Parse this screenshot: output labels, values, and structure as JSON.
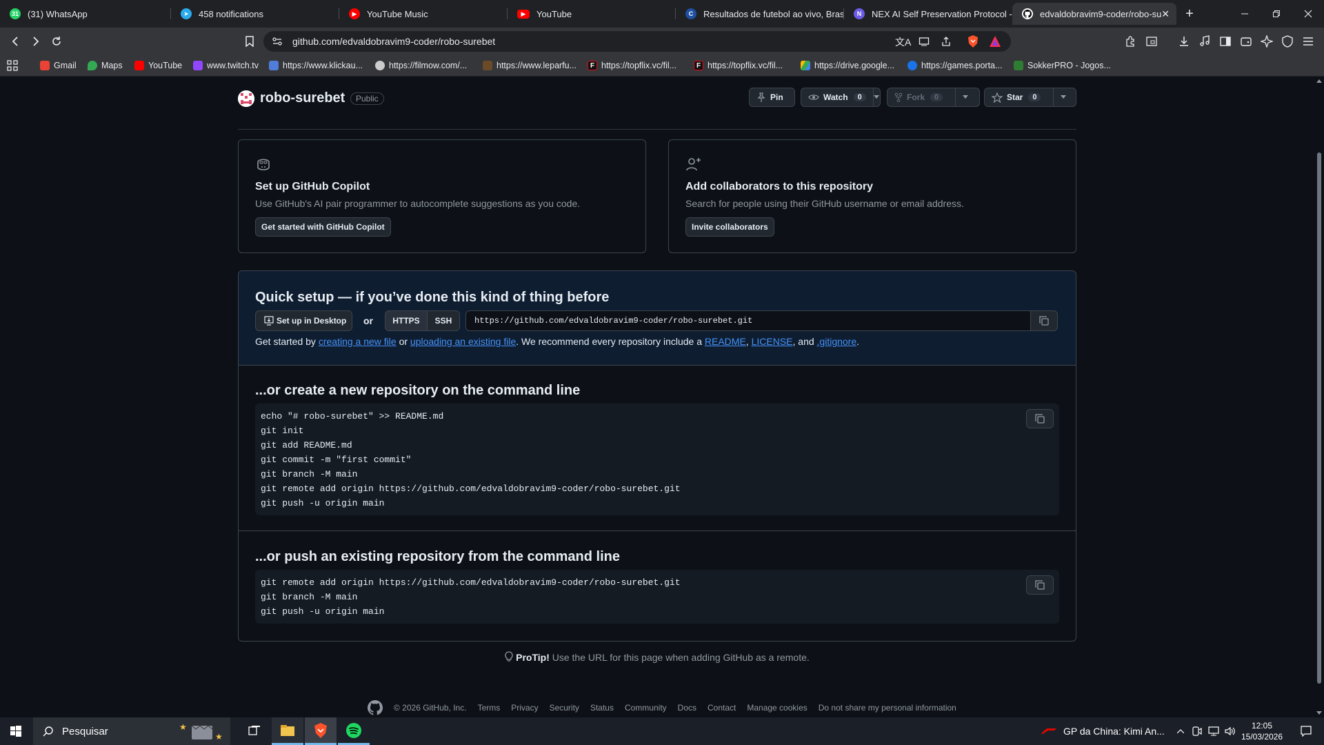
{
  "browser": {
    "tabs": [
      {
        "title": "(31) WhatsApp",
        "icon": "whatsapp-icon",
        "color": "#25d366"
      },
      {
        "title": "458 notifications",
        "icon": "telegram-icon",
        "color": "#2aabee"
      },
      {
        "title": "YouTube Music",
        "icon": "youtube-music-icon",
        "color": "#ff0000"
      },
      {
        "title": "YouTube",
        "icon": "youtube-icon",
        "color": "#ff0000"
      },
      {
        "title": "Resultados de futebol ao vivo, Brasile",
        "icon": "soccer-icon",
        "color": "#1f4fa0"
      },
      {
        "title": "NEX AI Self Preservation Protocol - D",
        "icon": "nex-icon",
        "color": "#6c5ce7"
      },
      {
        "title": "edvaldobravim9-coder/robo-su",
        "icon": "github-icon",
        "color": "#ffffff",
        "active": true
      }
    ],
    "url": "github.com/edvaldobravim9-coder/robo-surebet",
    "bookmarks": [
      {
        "label": "Gmail",
        "color": "#ea4335"
      },
      {
        "label": "Maps",
        "color": "#34a853"
      },
      {
        "label": "YouTube",
        "color": "#ff0000"
      },
      {
        "label": "www.twitch.tv",
        "color": "#9146ff"
      },
      {
        "label": "https://www.klickau...",
        "color": "#4f7dd9"
      },
      {
        "label": "https://filmow.com/...",
        "color": "#cccccc"
      },
      {
        "label": "https://www.leparfu...",
        "color": "#6b4a2a"
      },
      {
        "label": "https://topflix.vc/fil...",
        "color": "#111111"
      },
      {
        "label": "https://topflix.vc/fil...",
        "color": "#111111"
      },
      {
        "label": "https://drive.google...",
        "color": "#fbbc04"
      },
      {
        "label": "https://games.porta...",
        "color": "#1a73e8"
      },
      {
        "label": "SokkerPRO - Jogos...",
        "color": "#2e7d32"
      }
    ]
  },
  "repo": {
    "name": "robo-surebet",
    "visibility": "Public",
    "pin_label": "Pin",
    "watch_label": "Watch",
    "watch_count": "0",
    "fork_label": "Fork",
    "fork_count": "0",
    "star_label": "Star",
    "star_count": "0"
  },
  "copilot_card": {
    "title": "Set up GitHub Copilot",
    "desc": "Use GitHub's AI pair programmer to autocomplete suggestions as you code.",
    "button": "Get started with GitHub Copilot"
  },
  "collab_card": {
    "title": "Add collaborators to this repository",
    "desc": "Search for people using their GitHub username or email address.",
    "button": "Invite collaborators"
  },
  "quick_setup": {
    "title": "Quick setup — if you’ve done this kind of thing before",
    "desktop_button": "Set up in Desktop",
    "or": "or",
    "https": "HTTPS",
    "ssh": "SSH",
    "clone_url": "https://github.com/edvaldobravim9-coder/robo-surebet.git",
    "get_started": "Get started by",
    "link_new_file": "creating a new file",
    "or2": "or",
    "link_upload": "uploading an existing file",
    "recommend": ". We recommend every repository include a",
    "link_readme": "README",
    "comma": ",",
    "link_license": "LICENSE",
    "and": ", and",
    "link_gitignore": ".gitignore",
    "period": "."
  },
  "new_repo": {
    "title": "...or create a new repository on the command line",
    "code": "echo \"# robo-surebet\" >> README.md\ngit init\ngit add README.md\ngit commit -m \"first commit\"\ngit branch -M main\ngit remote add origin https://github.com/edvaldobravim9-coder/robo-surebet.git\ngit push -u origin main"
  },
  "push_repo": {
    "title": "...or push an existing repository from the command line",
    "code": "git remote add origin https://github.com/edvaldobravim9-coder/robo-surebet.git\ngit branch -M main\ngit push -u origin main"
  },
  "protip": {
    "bold": "ProTip!",
    "text": "Use the URL for this page when adding GitHub as a remote."
  },
  "footer": {
    "copyright": "© 2026 GitHub, Inc.",
    "links": [
      "Terms",
      "Privacy",
      "Security",
      "Status",
      "Community",
      "Docs",
      "Contact",
      "Manage cookies",
      "Do not share my personal information"
    ]
  },
  "taskbar": {
    "search_placeholder": "Pesquisar",
    "news": "GP da China: Kimi An...",
    "time": "12:05",
    "date": "15/03/2026"
  }
}
